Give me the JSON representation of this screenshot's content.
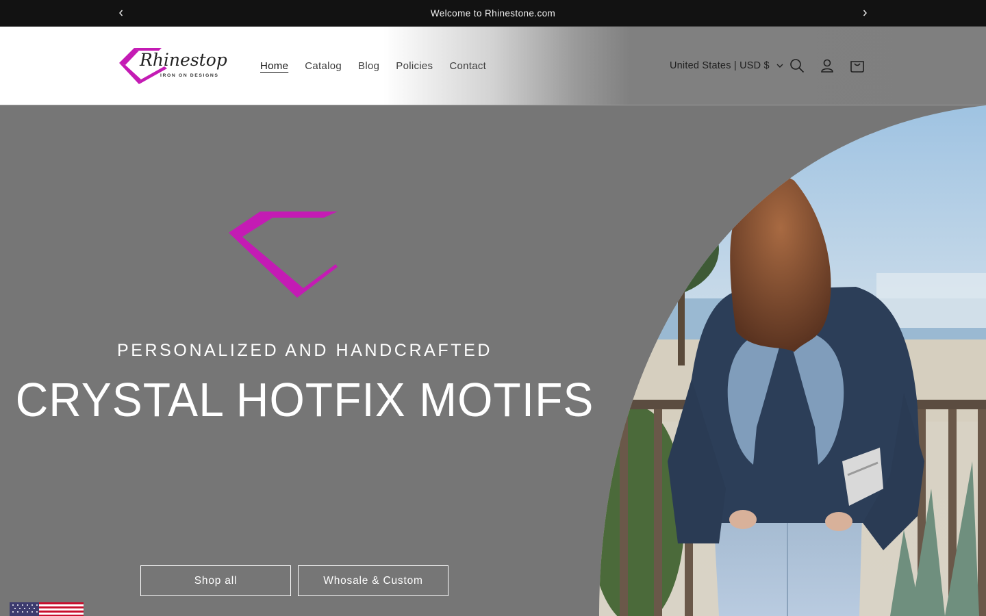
{
  "announcement": {
    "text": "Welcome to Rhinestone.com",
    "prev_icon": "chevron-left-icon",
    "next_icon": "chevron-right-icon"
  },
  "header": {
    "logo": {
      "name": "Rhinestop",
      "tagline": "IRON ON DESIGNS"
    },
    "nav": [
      {
        "label": "Home",
        "active": true
      },
      {
        "label": "Catalog",
        "active": false
      },
      {
        "label": "Blog",
        "active": false
      },
      {
        "label": "Policies",
        "active": false
      },
      {
        "label": "Contact",
        "active": false
      }
    ],
    "locale": "United States | USD $",
    "icons": [
      "search-icon",
      "account-icon",
      "cart-icon"
    ]
  },
  "hero": {
    "subheading": "PERSONALIZED AND HANDCRAFTED",
    "heading": "CRYSTAL HOTFIX MOTIFS",
    "buttons": [
      {
        "label": "Shop all"
      },
      {
        "label": "Whosale & Custom"
      }
    ],
    "photo": "woman-denim-shirt-rhinestone-wings-photo"
  },
  "colors": {
    "announcement_bg": "#121212",
    "hero_bg": "#767676",
    "brand_magenta": "#c41bb4",
    "text_white": "#ffffff"
  }
}
